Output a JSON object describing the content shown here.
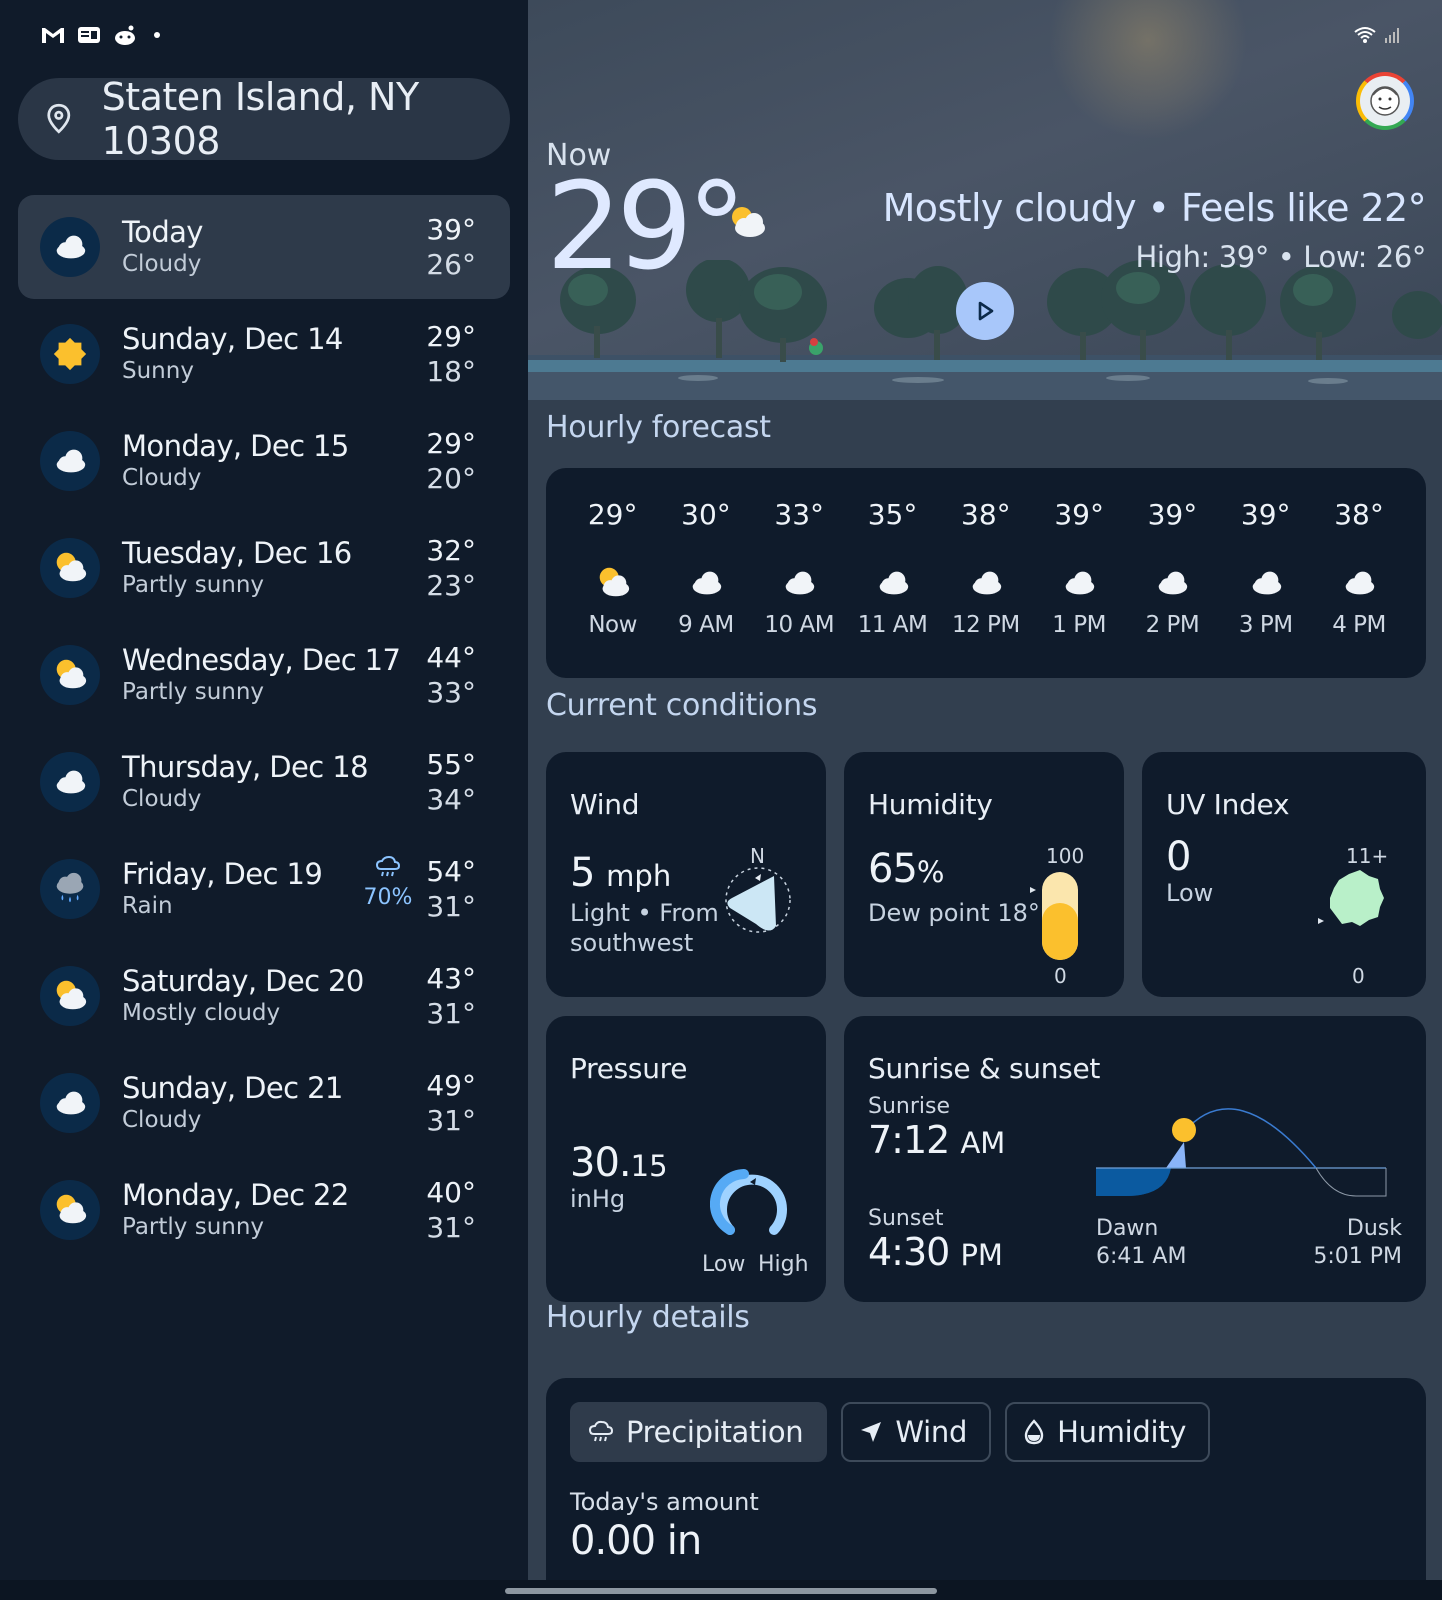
{
  "location": {
    "label": "Staten Island, NY 10308"
  },
  "forecast_days": [
    {
      "name": "Today",
      "condition": "Cloudy",
      "high": "39°",
      "low": "26°",
      "icon": "cloud-icon",
      "active": true
    },
    {
      "name": "Sunday, Dec 14",
      "condition": "Sunny",
      "high": "29°",
      "low": "18°",
      "icon": "sun-icon"
    },
    {
      "name": "Monday, Dec 15",
      "condition": "Cloudy",
      "high": "29°",
      "low": "20°",
      "icon": "cloud-icon"
    },
    {
      "name": "Tuesday, Dec 16",
      "condition": "Partly sunny",
      "high": "32°",
      "low": "23°",
      "icon": "partly-sunny-icon"
    },
    {
      "name": "Wednesday, Dec 17",
      "condition": "Partly sunny",
      "high": "44°",
      "low": "33°",
      "icon": "partly-sunny-icon"
    },
    {
      "name": "Thursday, Dec 18",
      "condition": "Cloudy",
      "high": "55°",
      "low": "34°",
      "icon": "cloud-icon"
    },
    {
      "name": "Friday, Dec 19",
      "condition": "Rain",
      "high": "54°",
      "low": "31°",
      "icon": "rain-icon",
      "precip": "70%"
    },
    {
      "name": "Saturday, Dec 20",
      "condition": "Mostly cloudy",
      "high": "43°",
      "low": "31°",
      "icon": "partly-sunny-icon"
    },
    {
      "name": "Sunday, Dec 21",
      "condition": "Cloudy",
      "high": "49°",
      "low": "31°",
      "icon": "cloud-icon"
    },
    {
      "name": "Monday, Dec 22",
      "condition": "Partly sunny",
      "high": "40°",
      "low": "31°",
      "icon": "partly-sunny-icon"
    }
  ],
  "current": {
    "now_label": "Now",
    "temp": "29°",
    "condition_line": "Mostly cloudy • Feels like 22°",
    "hilo_line": "High: 39° • Low: 26°"
  },
  "hourly": {
    "title": "Hourly forecast",
    "items": [
      {
        "temp": "29°",
        "label": "Now",
        "icon": "partly-sunny-icon"
      },
      {
        "temp": "30°",
        "label": "9 AM",
        "icon": "cloud-icon"
      },
      {
        "temp": "33°",
        "label": "10 AM",
        "icon": "cloud-icon"
      },
      {
        "temp": "35°",
        "label": "11 AM",
        "icon": "cloud-icon"
      },
      {
        "temp": "38°",
        "label": "12 PM",
        "icon": "cloud-icon"
      },
      {
        "temp": "39°",
        "label": "1 PM",
        "icon": "cloud-icon"
      },
      {
        "temp": "39°",
        "label": "2 PM",
        "icon": "cloud-icon"
      },
      {
        "temp": "39°",
        "label": "3 PM",
        "icon": "cloud-icon"
      },
      {
        "temp": "38°",
        "label": "4 PM",
        "icon": "cloud-icon"
      }
    ]
  },
  "conditions": {
    "title": "Current conditions",
    "wind": {
      "title": "Wind",
      "value": "5",
      "unit": "mph",
      "desc1": "Light • From",
      "desc2": "southwest",
      "compass": "N"
    },
    "humidity": {
      "title": "Humidity",
      "value": "65",
      "unit": "%",
      "dew": "Dew point 18°",
      "max": "100",
      "min": "0",
      "level": 0.65
    },
    "uv": {
      "title": "UV Index",
      "value": "0",
      "desc": "Low",
      "max": "11+",
      "min": "0"
    },
    "pressure": {
      "title": "Pressure",
      "value": "30.",
      "value_small": "15",
      "unit": "inHg",
      "low": "Low",
      "high": "High"
    },
    "sun": {
      "title": "Sunrise & sunset",
      "sunrise_label": "Sunrise",
      "sunrise": "7:12",
      "sunrise_ampm": "AM",
      "sunset_label": "Sunset",
      "sunset": "4:30",
      "sunset_ampm": "PM",
      "dawn_label": "Dawn",
      "dawn": "6:41 AM",
      "dusk_label": "Dusk",
      "dusk": "5:01 PM"
    }
  },
  "hourly_details": {
    "title": "Hourly details",
    "tabs": [
      {
        "label": "Precipitation",
        "icon": "rain-cloud-icon",
        "selected": true
      },
      {
        "label": "Wind",
        "icon": "wind-arrow-icon"
      },
      {
        "label": "Humidity",
        "icon": "droplet-icon"
      }
    ],
    "amount_label": "Today's amount",
    "amount": "0.00 in"
  },
  "colors": {
    "accent": "#a8c7fa",
    "sun": "#fbc02d",
    "uv": "#b9f0c9",
    "card": "#0f1b2b"
  }
}
